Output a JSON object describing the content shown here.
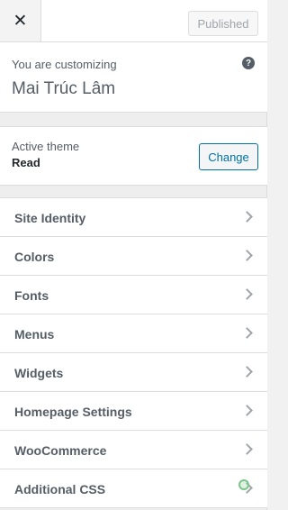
{
  "header": {
    "close_label": "✕",
    "publish_label": "Published"
  },
  "info": {
    "customizing_label": "You are customizing",
    "site_title": "Mai Trúc Lâm",
    "help_glyph": "?"
  },
  "theme": {
    "label": "Active theme",
    "name": "Read",
    "change_label": "Change"
  },
  "sections": [
    {
      "label": "Site Identity"
    },
    {
      "label": "Colors"
    },
    {
      "label": "Fonts"
    },
    {
      "label": "Menus"
    },
    {
      "label": "Widgets"
    },
    {
      "label": "Homepage Settings"
    },
    {
      "label": "WooCommerce"
    },
    {
      "label": "Additional CSS"
    }
  ],
  "colors": {
    "accent": "#0071a1",
    "text": "#555d66",
    "border": "#dddddd"
  },
  "icons": {
    "close": "close-icon",
    "help": "help-icon",
    "chevron": "chevron-right-icon"
  }
}
